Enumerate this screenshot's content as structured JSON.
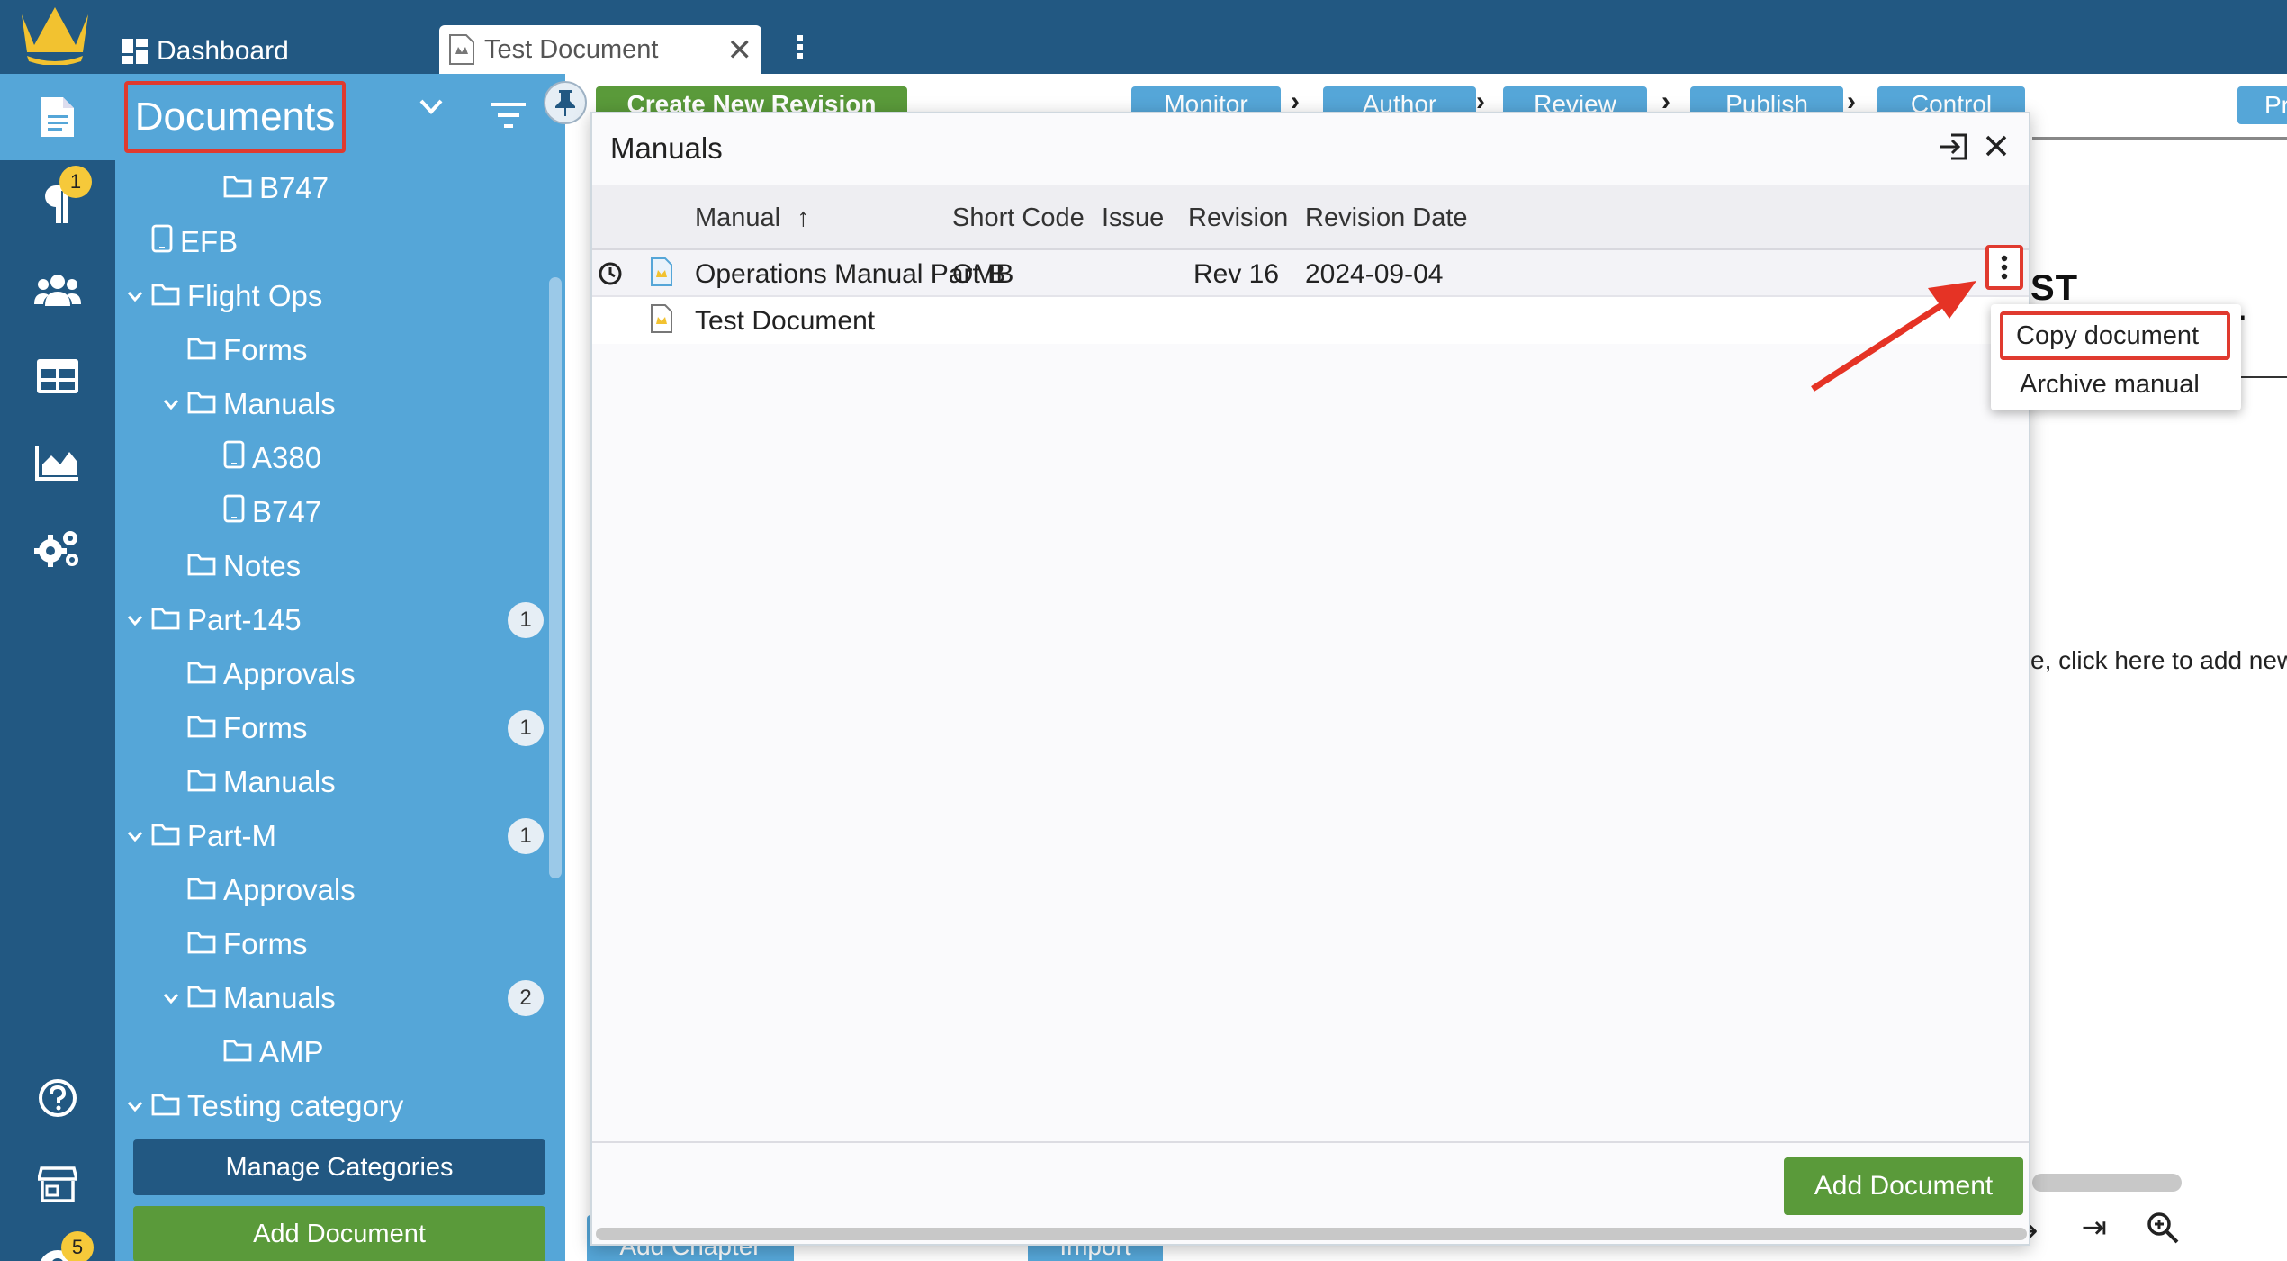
{
  "topbar": {
    "dashboard_label": "Dashboard",
    "doc_tab_label": "Test Document",
    "doc_tab_close": "✕"
  },
  "rail": {
    "items": [
      {
        "icon": "document-icon",
        "active": true
      },
      {
        "icon": "paragraph-icon",
        "badge": "1"
      },
      {
        "icon": "users-icon"
      },
      {
        "icon": "table-icon"
      },
      {
        "icon": "chart-icon"
      },
      {
        "icon": "gears-icon"
      }
    ],
    "bottom": [
      {
        "icon": "help-icon"
      },
      {
        "icon": "store-icon"
      },
      {
        "icon": "user-icon",
        "badge": "5"
      }
    ]
  },
  "tree": {
    "header": "Documents",
    "nodes": [
      {
        "label": "B747",
        "type": "folder",
        "depth": 3
      },
      {
        "label": "EFB",
        "type": "device",
        "depth": 1
      },
      {
        "label": "Flight Ops",
        "type": "folder",
        "depth": 1,
        "expanded": true
      },
      {
        "label": "Forms",
        "type": "folder",
        "depth": 2
      },
      {
        "label": "Manuals",
        "type": "folder",
        "depth": 2,
        "expanded": true
      },
      {
        "label": "A380",
        "type": "device",
        "depth": 3
      },
      {
        "label": "B747",
        "type": "device",
        "depth": 3
      },
      {
        "label": "Notes",
        "type": "folder",
        "depth": 2
      },
      {
        "label": "Part-145",
        "type": "folder",
        "depth": 1,
        "expanded": true,
        "count": "1"
      },
      {
        "label": "Approvals",
        "type": "folder",
        "depth": 2
      },
      {
        "label": "Forms",
        "type": "folder",
        "depth": 2,
        "count": "1"
      },
      {
        "label": "Manuals",
        "type": "folder",
        "depth": 2
      },
      {
        "label": "Part-M",
        "type": "folder",
        "depth": 1,
        "expanded": true,
        "count": "1"
      },
      {
        "label": "Approvals",
        "type": "folder",
        "depth": 2
      },
      {
        "label": "Forms",
        "type": "folder",
        "depth": 2
      },
      {
        "label": "Manuals",
        "type": "folder",
        "depth": 2,
        "expanded": true,
        "count": "2"
      },
      {
        "label": "AMP",
        "type": "folder",
        "depth": 3
      },
      {
        "label": "Testing category",
        "type": "folder",
        "depth": 1,
        "expanded": true
      }
    ],
    "manage_categories": "Manage Categories",
    "add_document": "Add Document"
  },
  "workflow": {
    "create_new_revision": "Create New Revision",
    "steps": [
      "Monitor",
      "Author",
      "Review",
      "Publish",
      "Control"
    ],
    "right_button": "Pr"
  },
  "background_doc": {
    "title": "ST DOCUMENT",
    "hint": "e, click here to add new"
  },
  "bottom_buttons": [
    "Add Chapter",
    "Import"
  ],
  "modal": {
    "title": "Manuals",
    "columns": [
      "Manual",
      "Short Code",
      "Issue",
      "Revision",
      "Revision Date"
    ],
    "sort_indicator": "↑",
    "rows": [
      {
        "manual": "Operations Manual Part B",
        "short_code": "OMB",
        "issue": "",
        "revision": "Rev 16",
        "revision_date": "2024-09-04"
      },
      {
        "manual": "Test Document",
        "short_code": "",
        "issue": "",
        "revision": "",
        "revision_date": ""
      }
    ],
    "add_document": "Add Document"
  },
  "context_menu": {
    "items": [
      "Copy document",
      "Archive manual"
    ]
  },
  "colors": {
    "navy": "#225882",
    "sky": "#55a6d8",
    "green": "#5a9a3a",
    "highlight_red": "#e03a2f",
    "badge_yellow": "#f6c93a"
  }
}
